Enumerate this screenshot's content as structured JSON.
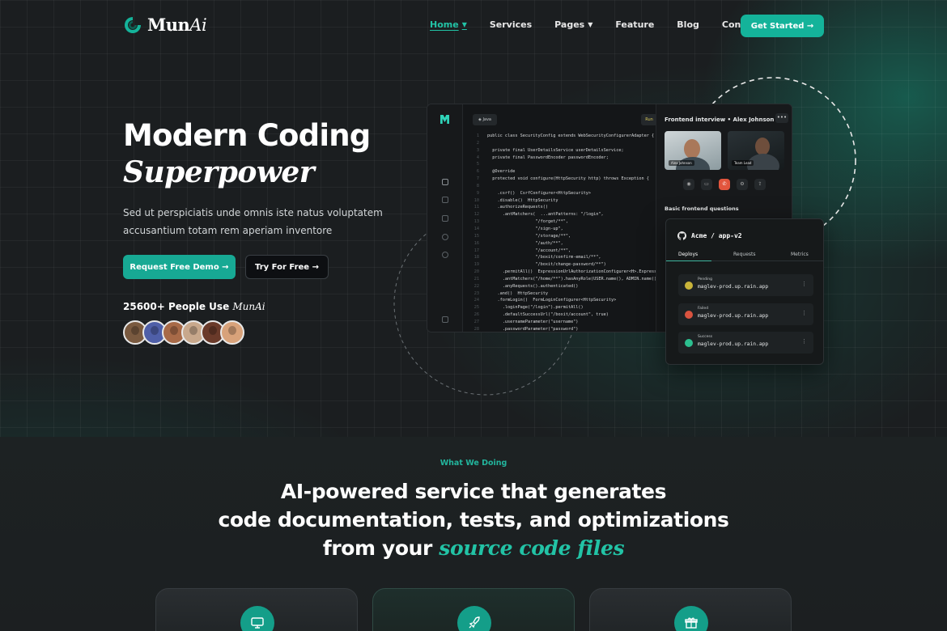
{
  "brand": {
    "name_main": "Mun",
    "name_ai": "Ai",
    "accent": "#14b39a"
  },
  "nav": {
    "items": [
      {
        "label": "Home",
        "dropdown": true,
        "active": true
      },
      {
        "label": "Services",
        "dropdown": false,
        "active": false
      },
      {
        "label": "Pages",
        "dropdown": true,
        "active": false
      },
      {
        "label": "Feature",
        "dropdown": false,
        "active": false
      },
      {
        "label": "Blog",
        "dropdown": false,
        "active": false
      },
      {
        "label": "Contact",
        "dropdown": false,
        "active": false
      }
    ],
    "cta_label": "Get Started →"
  },
  "hero": {
    "title_line1": "Modern Coding",
    "title_line2": "Superpower",
    "description": "Sed ut perspiciatis unde omnis iste natus voluptatem accusantium totam rem aperiam inventore",
    "primary_button": "Request Free Demo →",
    "secondary_button": "Try For Free →",
    "people_count": "25600+ People Use ",
    "people_brand": "MunAi"
  },
  "code_panel": {
    "tab_label": "Java",
    "run_label": "Run",
    "more_label": ">_",
    "lines": [
      "public class SecurityConfig extends WebSecurityConfigurerAdapter {",
      "",
      "  private final UserDetailsService userDetailsService;",
      "  private final PasswordEncoder passwordEncoder;",
      "",
      "  @Override",
      "  protected void configure(HttpSecurity http) throws Exception {",
      "",
      "    .csrf()  CsrfConfigurer<HttpSecurity>",
      "    .disable()  HttpSecurity",
      "    .authorizeRequests()",
      "      .antMatchers(  ...antPatterns: \"/login\",",
      "                   \"/forget/**\",",
      "                   \"/sign-up\",",
      "                   \"/storage/**\",",
      "                   \"/auth/**\",",
      "                   \"/account/**\",",
      "                   \"/boxit/confirm-email/**\",",
      "                   \"/boxit/change-password/**\")",
      "      .permitAll()  ExpressionUrlAuthorizationConfigurer<H>.ExpressionInterceptUrl",
      "      .antMatchers(\"/home/**\").hasAnyRole(USER.name(), ADMIN.name())",
      "      .anyRequests().authenticated()",
      "    .and()  HttpSecurity",
      "    .formLogin()  FormLoginConfigurer<HttpSecurity>",
      "      .loginPage(\"/login\").permitAll()",
      "      .defaultSuccessUrl(\"/boxit/account\", true)",
      "      .usernameParameter(\"username\")",
      "      .passwordParameter(\"password\")"
    ],
    "line_numbers": [
      "1",
      "2",
      "3",
      "4",
      "5",
      "6",
      "7",
      "8",
      "9",
      "10",
      "11",
      "12",
      "13",
      "14",
      "15",
      "16",
      "17",
      "18",
      "19",
      "20",
      "21",
      "22",
      "23",
      "24",
      "25",
      "26",
      "27",
      "28"
    ],
    "interview_title": "Frontend interview • Alex Johnson",
    "more_dots": "•••",
    "video_left_caption": "Alex Johnson",
    "video_right_caption": "Team Lead",
    "questions_title": "Basic frontend questions"
  },
  "deploy_panel": {
    "title": "Acme / app-v2",
    "tabs": [
      "Deploys",
      "Requests",
      "Metrics"
    ],
    "items": [
      {
        "status": "Pending",
        "host": "maglev-prod.up.rain.app",
        "color": "#c9b43a"
      },
      {
        "status": "Failed",
        "host": "maglev-prod.up.rain.app",
        "color": "#d9533f"
      },
      {
        "status": "Success",
        "host": "maglev-prod.up.rain.app",
        "color": "#2cbf8f"
      }
    ],
    "kebab": "⋮"
  },
  "section": {
    "eyebrow": "What We Doing",
    "title_line1": "AI-powered service that generates",
    "title_line2": "code documentation, tests, and optimizations",
    "title_line3_prefix": "from your ",
    "title_line3_accent": "source code files"
  },
  "cards": [
    {
      "icon": "monitor-code-icon"
    },
    {
      "icon": "rocket-icon"
    },
    {
      "icon": "gift-icon"
    }
  ]
}
